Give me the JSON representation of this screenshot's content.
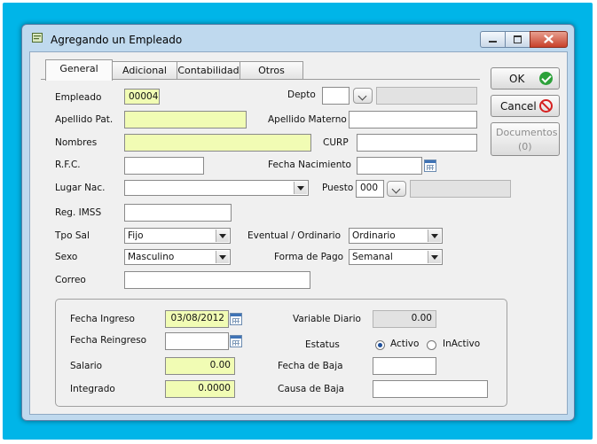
{
  "window": {
    "title": "Agregando un Empleado"
  },
  "tabs": [
    {
      "label": "General",
      "active": true
    },
    {
      "label": "Adicional",
      "active": false
    },
    {
      "label": "Contabilidad",
      "active": false
    },
    {
      "label": "Otros",
      "active": false
    }
  ],
  "form": {
    "empleado": {
      "label": "Empleado",
      "value": "00004"
    },
    "depto": {
      "label": "Depto",
      "value": "",
      "description": ""
    },
    "apellido_pat": {
      "label": "Apellido Pat.",
      "value": ""
    },
    "apellido_materno": {
      "label": "Apellido Materno",
      "value": ""
    },
    "nombres": {
      "label": "Nombres",
      "value": ""
    },
    "curp": {
      "label": "CURP",
      "value": ""
    },
    "rfc": {
      "label": "R.F.C.",
      "value": ""
    },
    "fecha_nacimiento": {
      "label": "Fecha Nacimiento",
      "value": ""
    },
    "lugar_nac": {
      "label": "Lugar Nac.",
      "value": ""
    },
    "puesto": {
      "label": "Puesto",
      "value": "000",
      "description": ""
    },
    "reg_imss": {
      "label": "Reg. IMSS",
      "value": ""
    },
    "tpo_sal": {
      "label": "Tpo Sal",
      "value": "Fijo"
    },
    "eventual_ordinario": {
      "label": "Eventual / Ordinario",
      "value": "Ordinario"
    },
    "sexo": {
      "label": "Sexo",
      "value": "Masculino"
    },
    "forma_pago": {
      "label": "Forma de Pago",
      "value": "Semanal"
    },
    "correo": {
      "label": "Correo",
      "value": ""
    }
  },
  "group": {
    "fecha_ingreso": {
      "label": "Fecha Ingreso",
      "value": "03/08/2012"
    },
    "variable_diario": {
      "label": "Variable Diario",
      "value": "0.00"
    },
    "fecha_reingreso": {
      "label": "Fecha Reingreso",
      "value": ""
    },
    "estatus": {
      "label": "Estatus",
      "options": [
        "Activo",
        "InActivo"
      ],
      "selected": "Activo"
    },
    "salario": {
      "label": "Salario",
      "value": "0.00"
    },
    "fecha_baja": {
      "label": "Fecha de Baja",
      "value": ""
    },
    "integrado": {
      "label": "Integrado",
      "value": "0.0000"
    },
    "causa_baja": {
      "label": "Causa de Baja",
      "value": ""
    }
  },
  "buttons": {
    "ok": "OK",
    "cancel": "Cancel",
    "documentos": "Documentos",
    "documentos_count": "(0)"
  },
  "colors": {
    "required_field": "#f1fcb4",
    "frame": "#00b5e8",
    "ok_icon": "#2ca13a",
    "cancel_icon": "#d62020"
  },
  "icons": {
    "window": "form-icon",
    "ok": "check-circle-icon",
    "cancel": "no-entry-icon",
    "date_picker": "calendar-icon"
  }
}
